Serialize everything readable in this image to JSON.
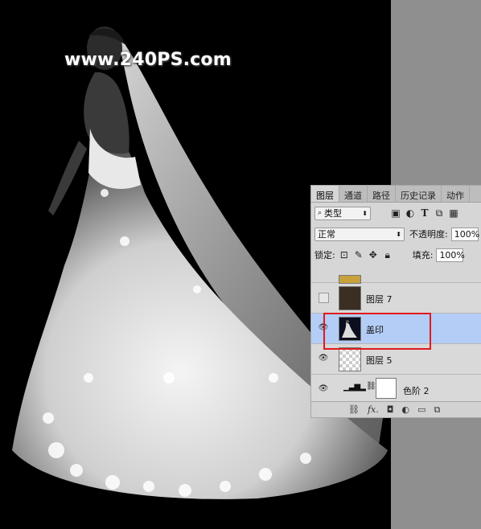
{
  "watermark": "www.240PS.com",
  "panel": {
    "tabs": [
      "图层",
      "通道",
      "路径",
      "历史记录",
      "动作"
    ],
    "filter_label": "类型",
    "blend_mode": "正常",
    "opacity_label": "不透明度:",
    "opacity_value": "100%",
    "lock_label": "锁定:",
    "fill_label": "填充:",
    "fill_value": "100%",
    "layers": [
      {
        "name": "图层 7",
        "visible": false,
        "thumb": "brown"
      },
      {
        "name": "盖印",
        "visible": true,
        "selected": true,
        "thumb": "dress"
      },
      {
        "name": "图层 5",
        "visible": true,
        "thumb": "transparent"
      },
      {
        "name": "色阶 2",
        "visible": true,
        "thumb": "adjustment"
      }
    ],
    "footer_icons": [
      "link-icon",
      "fx-icon",
      "mask-icon",
      "adjustment-icon",
      "folder-icon",
      "new-layer-icon"
    ],
    "fx_label": "fx."
  },
  "colors": {
    "selection": "#b4cdf6",
    "highlight_box": "#e0191e",
    "canvas_bg": "#000000",
    "workspace_gray": "#8f8f8f"
  }
}
